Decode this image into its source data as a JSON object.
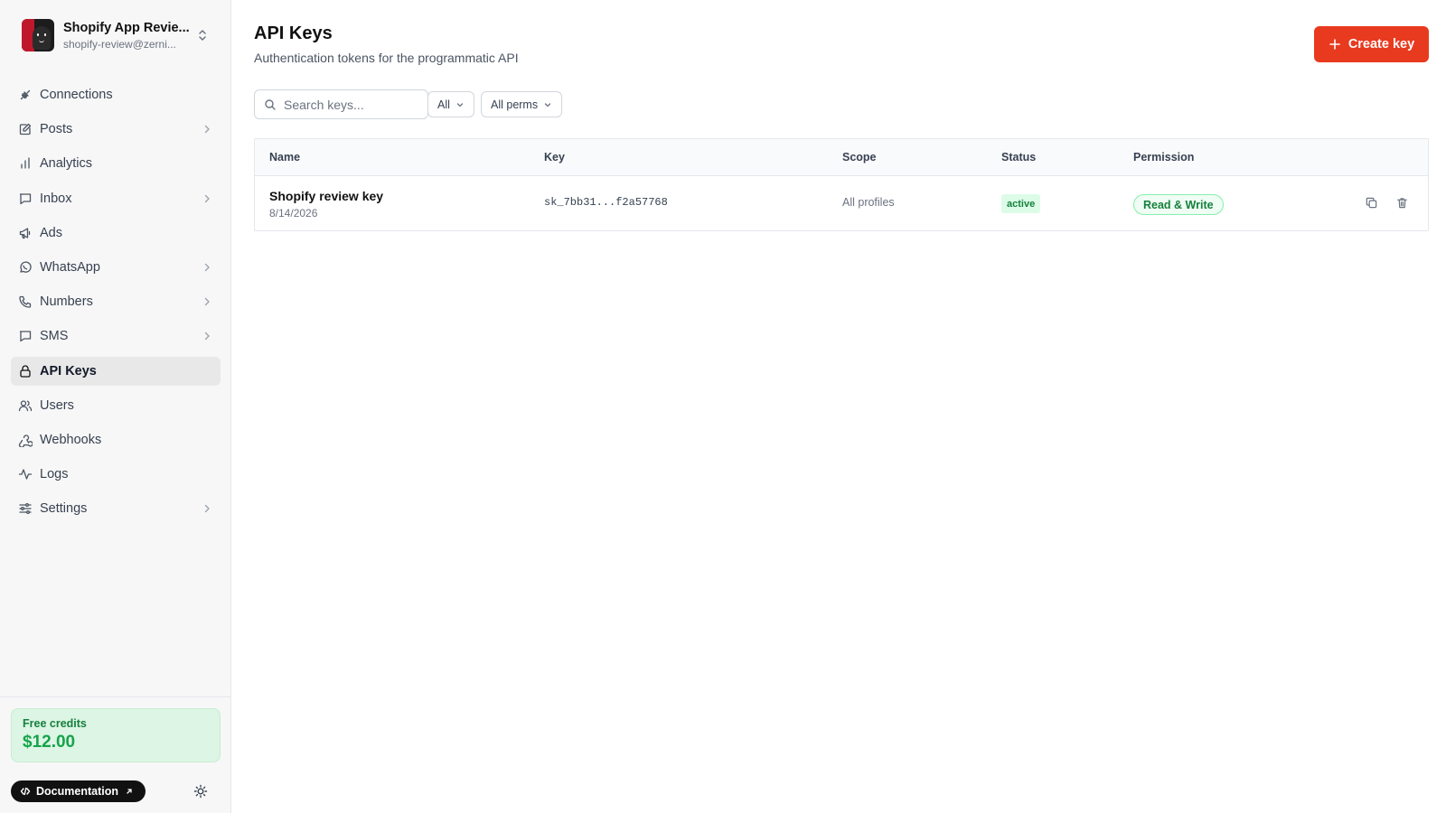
{
  "account": {
    "name": "Shopify App Revie...",
    "email": "shopify-review@zerni..."
  },
  "nav": [
    {
      "label": "Connections",
      "icon": "plug-icon",
      "chevron": false,
      "active": false
    },
    {
      "label": "Posts",
      "icon": "edit-icon",
      "chevron": true,
      "active": false
    },
    {
      "label": "Analytics",
      "icon": "bar-chart-icon",
      "chevron": false,
      "active": false
    },
    {
      "label": "Inbox",
      "icon": "message-icon",
      "chevron": true,
      "active": false
    },
    {
      "label": "Ads",
      "icon": "megaphone-icon",
      "chevron": false,
      "active": false
    },
    {
      "label": "WhatsApp",
      "icon": "whatsapp-icon",
      "chevron": true,
      "active": false
    },
    {
      "label": "Numbers",
      "icon": "phone-icon",
      "chevron": true,
      "active": false
    },
    {
      "label": "SMS",
      "icon": "message-icon",
      "chevron": true,
      "active": false
    },
    {
      "label": "API Keys",
      "icon": "lock-icon",
      "chevron": false,
      "active": true
    },
    {
      "label": "Users",
      "icon": "users-icon",
      "chevron": false,
      "active": false
    },
    {
      "label": "Webhooks",
      "icon": "webhook-icon",
      "chevron": false,
      "active": false
    },
    {
      "label": "Logs",
      "icon": "activity-icon",
      "chevron": false,
      "active": false
    },
    {
      "label": "Settings",
      "icon": "sliders-icon",
      "chevron": true,
      "active": false
    }
  ],
  "credits": {
    "label": "Free credits",
    "value": "$12.00"
  },
  "docs_label": "Documentation",
  "page": {
    "title": "API Keys",
    "subtitle": "Authentication tokens for the programmatic API",
    "create_label": "Create key"
  },
  "search": {
    "placeholder": "Search keys..."
  },
  "filters": {
    "status": "All",
    "perms": "All perms"
  },
  "table": {
    "headers": {
      "name": "Name",
      "key": "Key",
      "scope": "Scope",
      "status": "Status",
      "permission": "Permission"
    },
    "rows": [
      {
        "name": "Shopify review key",
        "date": "8/14/2026",
        "key": "sk_7bb31...f2a57768",
        "scope": "All profiles",
        "status": "active",
        "permission": "Read & Write"
      }
    ]
  },
  "colors": {
    "accent": "#e83a1f",
    "success": "#16a34a",
    "sidebar_bg": "#f7f7f7"
  }
}
